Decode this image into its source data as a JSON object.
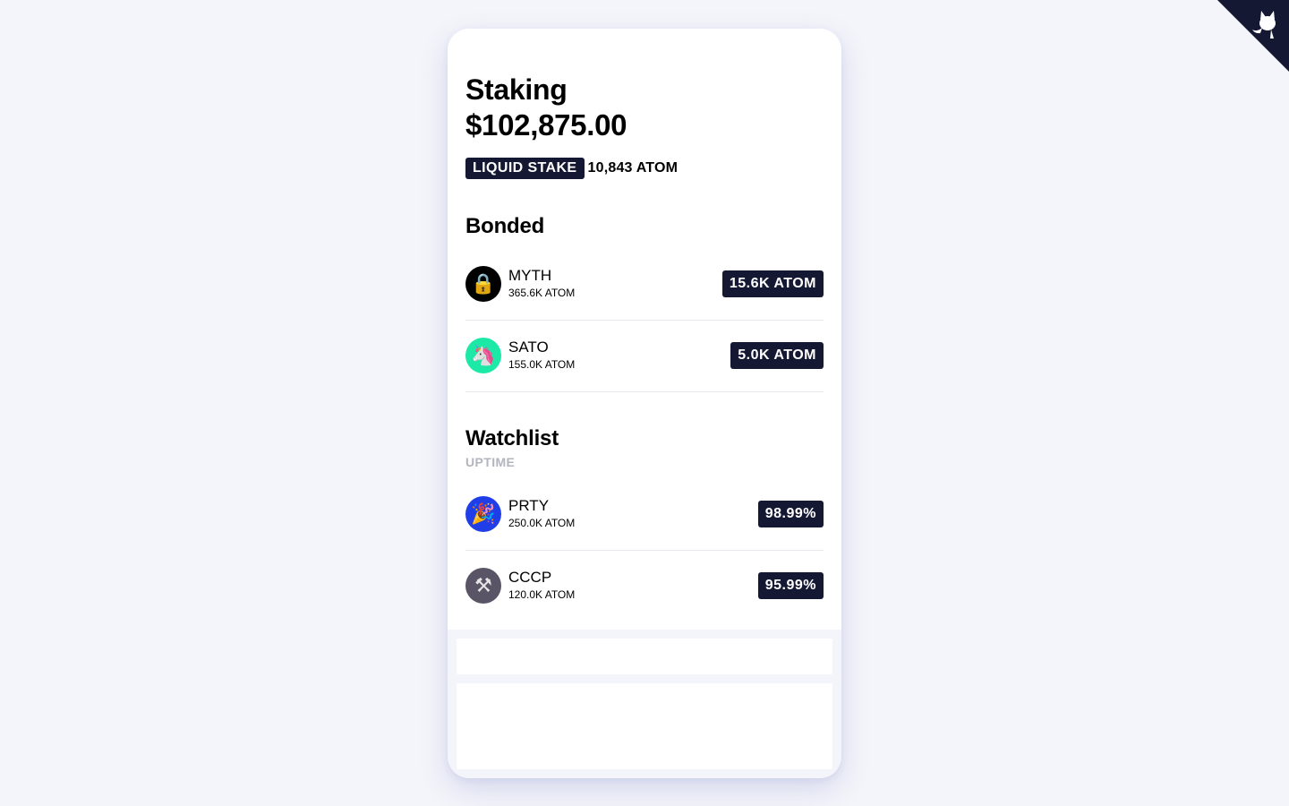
{
  "header": {
    "title": "Staking",
    "total_value": "$102,875.00",
    "liquid_label": "LIQUID STAKE",
    "liquid_amount": "10,843 ATOM"
  },
  "bonded": {
    "title": "Bonded",
    "items": [
      {
        "name": "MYTH",
        "sub": "365.6K ATOM",
        "badge": "15.6K ATOM",
        "icon": "lock-icon",
        "glyph": "🔒",
        "bg": "#000000"
      },
      {
        "name": "SATO",
        "sub": "155.0K ATOM",
        "badge": "5.0K ATOM",
        "icon": "unicorn-icon",
        "glyph": "🦄",
        "bg": "#1de9a6"
      }
    ]
  },
  "watchlist": {
    "title": "Watchlist",
    "subtitle": "UPTIME",
    "items": [
      {
        "name": "PRTY",
        "sub": "250.0K ATOM",
        "badge": "98.99%",
        "icon": "party-popper-icon",
        "glyph": "🎉",
        "bg": "#1f3ee8"
      },
      {
        "name": "CCCP",
        "sub": "120.0K ATOM",
        "badge": "95.99%",
        "icon": "hammer-wrench-icon",
        "glyph": "⚒",
        "bg": "#5a5566"
      }
    ]
  },
  "colors": {
    "accent": "#141833",
    "background": "#f4f5fa",
    "muted": "#b2b4bf"
  }
}
